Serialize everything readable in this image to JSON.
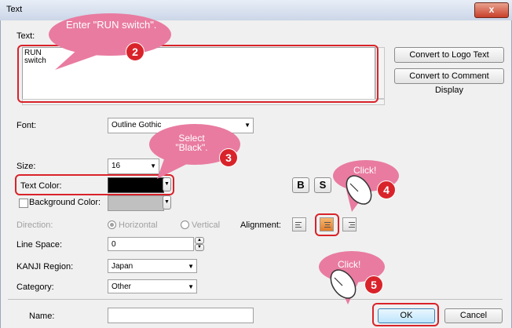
{
  "window": {
    "title": "Text",
    "close_label": "x"
  },
  "text_section": {
    "label": "Text:",
    "lines": [
      "RUN",
      "switch"
    ],
    "convert_logo_label": "Convert to Logo Text",
    "convert_comment_label": "Convert to Comment Display"
  },
  "font": {
    "label": "Font:",
    "value": "Outline Gothic"
  },
  "size": {
    "label": "Size:",
    "value": "16"
  },
  "text_color": {
    "label": "Text Color:",
    "value": "#000000"
  },
  "background_color": {
    "label": "Background Color:",
    "value": "#c0c0c0",
    "checked": false
  },
  "style_buttons": {
    "bold": "B",
    "shadow": "S"
  },
  "direction": {
    "label": "Direction:",
    "horizontal": "Horizontal",
    "vertical": "Vertical",
    "selected": "Horizontal"
  },
  "alignment": {
    "label": "Alignment:",
    "selected": "center"
  },
  "line_space": {
    "label": "Line Space:",
    "value": "0"
  },
  "kanji_region": {
    "label": "KANJI Region:",
    "value": "Japan"
  },
  "category": {
    "label": "Category:",
    "value": "Other"
  },
  "name": {
    "label": "Name:",
    "value": ""
  },
  "buttons": {
    "ok": "OK",
    "cancel": "Cancel"
  },
  "callouts": {
    "c2": {
      "text": "Enter \"RUN switch\".",
      "number": "2"
    },
    "c3": {
      "text": "Select \"Black\".",
      "number": "3"
    },
    "c4": {
      "text": "Click!",
      "number": "4"
    },
    "c5": {
      "text": "Click!",
      "number": "5"
    }
  },
  "colors": {
    "highlight": "#d9232a",
    "bubble": "#e97ba0"
  }
}
